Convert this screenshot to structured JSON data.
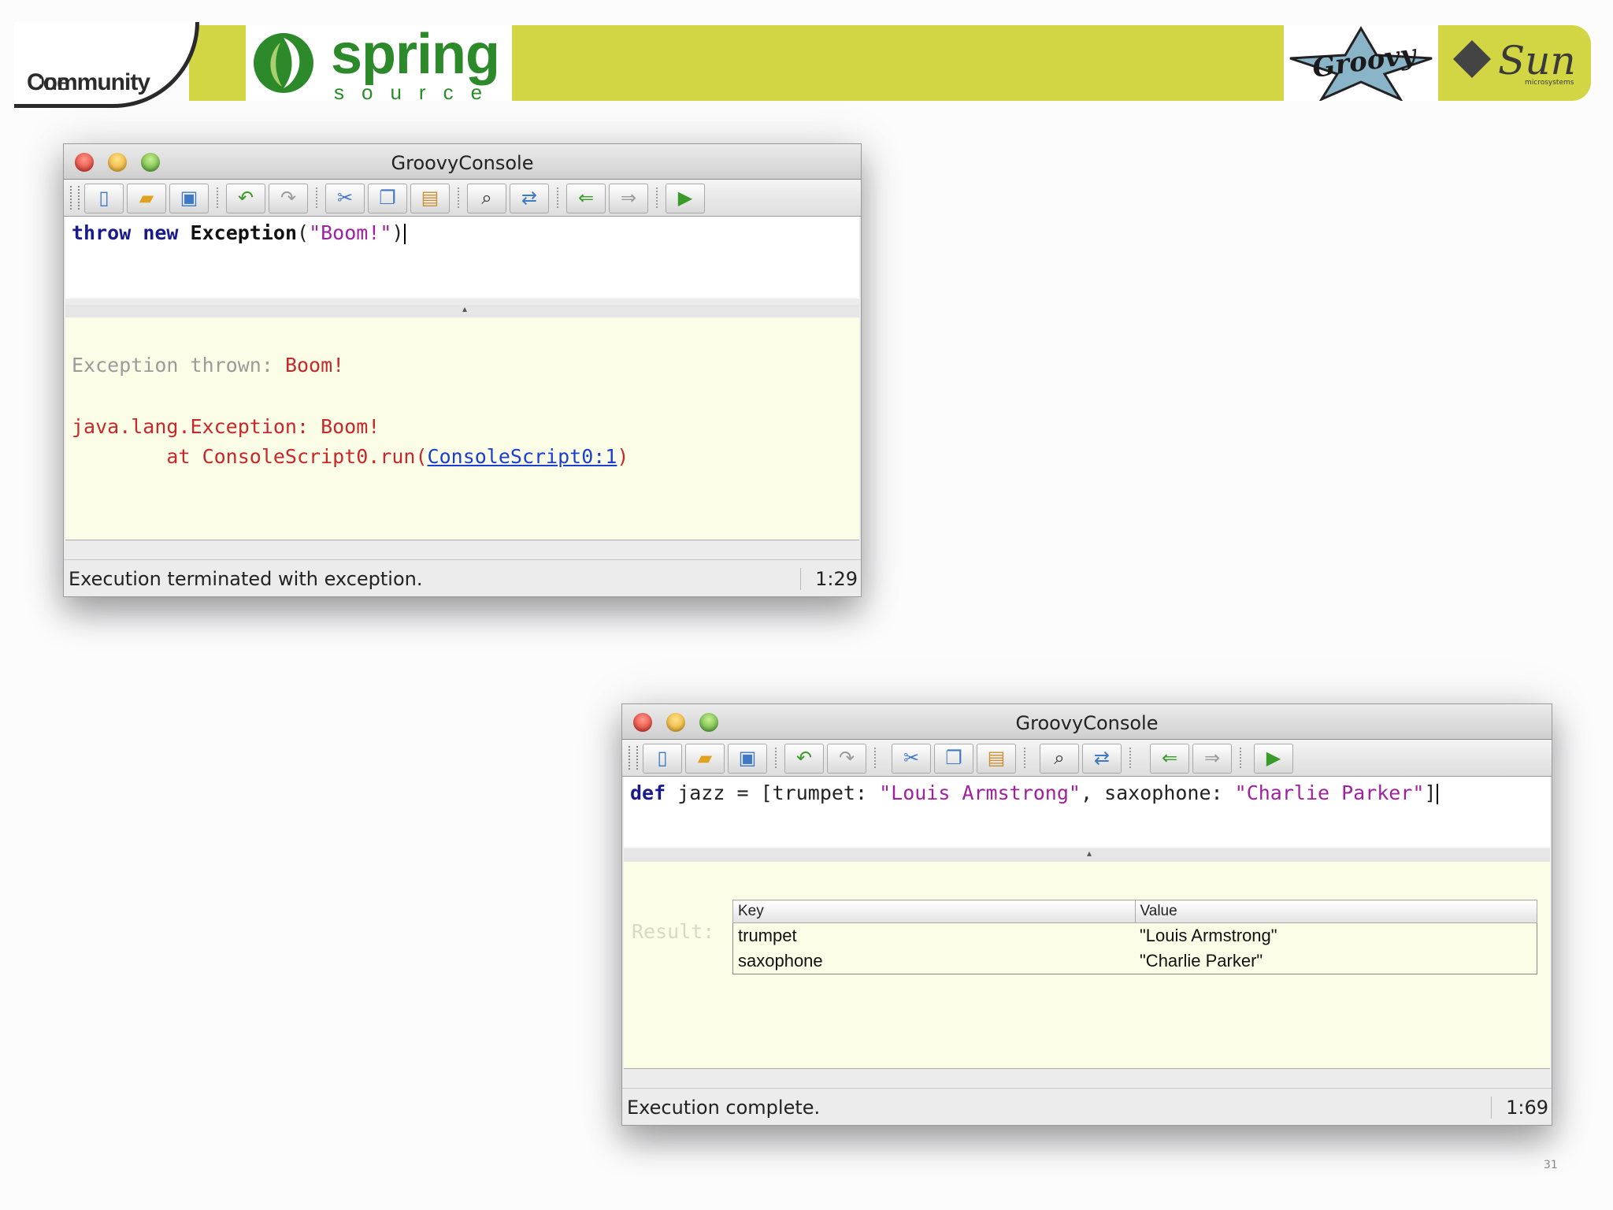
{
  "header": {
    "community_one": {
      "bold": "Community",
      "rest": "One"
    },
    "spring_word": "spring",
    "spring_reg": "®",
    "spring_source": "source",
    "groovy_logo": "Groovy",
    "sun_logo": "Sun",
    "sun_sub": "microsystems"
  },
  "window1": {
    "title": "GroovyConsole",
    "toolbar": [
      "new-document-icon",
      "open-folder-icon",
      "save-icon",
      "undo-icon",
      "redo-icon",
      "cut-icon",
      "copy-icon",
      "paste-icon",
      "find-icon",
      "replace-icon",
      "previous-history-icon",
      "next-history-icon",
      "run-script-icon"
    ],
    "code": {
      "kw1": "throw",
      "kw2": "new",
      "cls": "Exception",
      "open": "(",
      "str": "\"Boom!\"",
      "close": ")"
    },
    "output": {
      "line1_label": "Exception thrown: ",
      "line1_msg": "Boom!",
      "line2": "java.lang.Exception: Boom!",
      "line3_prefix": "        at ConsoleScript0.run(",
      "line3_link": "ConsoleScript0:1",
      "line3_suffix": ")"
    },
    "status": "Execution terminated with exception.",
    "position": "1:29"
  },
  "window2": {
    "title": "GroovyConsole",
    "code": {
      "kw": "def",
      "part1": " jazz = [trumpet: ",
      "str1": "\"Louis Armstrong\"",
      "part2": ", saxophone: ",
      "str2": "\"Charlie Parker\"",
      "part3": "]"
    },
    "result_label": "Result:",
    "table": {
      "headers": [
        "Key",
        "Value"
      ],
      "rows": [
        [
          "trumpet",
          "\"Louis Armstrong\""
        ],
        [
          "saxophone",
          "\"Charlie Parker\""
        ]
      ]
    },
    "status": "Execution complete.",
    "position": "1:69"
  },
  "page_number": "31"
}
